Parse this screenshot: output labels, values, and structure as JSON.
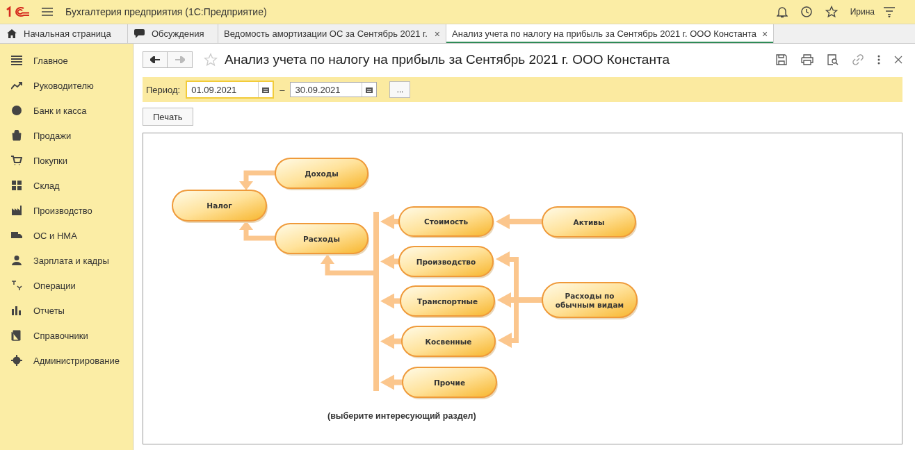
{
  "app": {
    "title": "Бухгалтерия предприятия  (1С:Предприятие)",
    "user": "Ирина"
  },
  "tabs": [
    {
      "label": "Начальная страница",
      "selected": false
    },
    {
      "label": "Обсуждения",
      "selected": false
    },
    {
      "label": "Ведомость амортизации ОС за Сентябрь 2021 г.",
      "close": "×",
      "selected": false
    },
    {
      "label": "Анализ учета по налогу на прибыль за Сентябрь 2021 г. ООО Константа",
      "close": "×",
      "selected": true
    }
  ],
  "sidebar": {
    "items": [
      {
        "label": "Главное"
      },
      {
        "label": "Руководителю"
      },
      {
        "label": "Банк и касса"
      },
      {
        "label": "Продажи"
      },
      {
        "label": "Покупки"
      },
      {
        "label": "Склад"
      },
      {
        "label": "Производство"
      },
      {
        "label": "ОС и НМА"
      },
      {
        "label": "Зарплата и кадры"
      },
      {
        "label": "Операции"
      },
      {
        "label": "Отчеты"
      },
      {
        "label": "Справочники"
      },
      {
        "label": "Администрирование"
      }
    ]
  },
  "form": {
    "title": "Анализ учета по налогу на прибыль за Сентябрь 2021 г. ООО Константа",
    "period": {
      "label": "Период:",
      "from": "01.09.2021",
      "dash": "–",
      "to": "30.09.2021",
      "more": "..."
    },
    "print_button": "Печать",
    "diagram": {
      "nodes": [
        {
          "label": "Доходы"
        },
        {
          "label": "Налог"
        },
        {
          "label": "Расходы"
        },
        {
          "label": "Стоимость"
        },
        {
          "label": "Производство"
        },
        {
          "label": "Транспортные"
        },
        {
          "label": "Косвенные"
        },
        {
          "label": "Прочие"
        },
        {
          "label": "Активы"
        },
        {
          "label": "Расходы по обычным видам"
        }
      ],
      "note": "(выберите интересующий раздел)"
    }
  }
}
